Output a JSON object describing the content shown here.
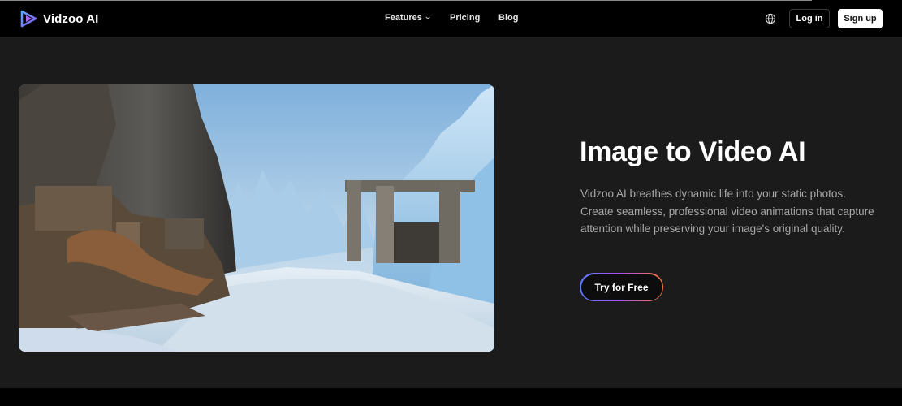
{
  "header": {
    "brand_name": "Vidzoo AI",
    "nav": {
      "features": "Features",
      "pricing": "Pricing",
      "blog": "Blog"
    },
    "language_icon": "globe-icon",
    "login_label": "Log in",
    "signup_label": "Sign up"
  },
  "hero": {
    "image_subject": "frozen canyon with abandoned machinery and ruins",
    "title": "Image to Video AI",
    "description": "Vidzoo AI breathes dynamic life into your static photos. Create seamless, professional video animations that capture attention while preserving your image's original quality.",
    "cta_label": "Try for Free"
  },
  "colors": {
    "background": "#1b1b1b",
    "header_background": "#000000",
    "text_primary": "#ffffff",
    "text_secondary": "#a8a8a8",
    "cta_gradient": [
      "#5b7cff",
      "#b04df0",
      "#ff7a3a"
    ]
  }
}
